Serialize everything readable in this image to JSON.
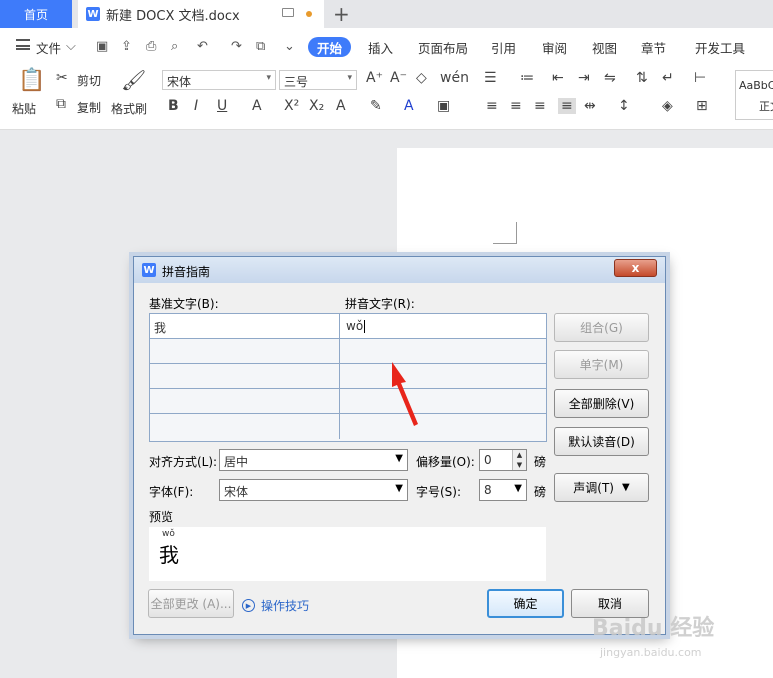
{
  "tabs": {
    "home": "首页",
    "document": "新建 DOCX 文档.docx",
    "add": "+"
  },
  "menu": {
    "file": "文件",
    "items": [
      "开始",
      "插入",
      "页面布局",
      "引用",
      "审阅",
      "视图",
      "章节",
      "开发工具"
    ]
  },
  "ribbon": {
    "paste": "粘贴",
    "cut": "剪切",
    "copy": "复制",
    "format_painter": "格式刷",
    "font_name": "宋体",
    "font_size": "三号",
    "style_preview": "AaBbC",
    "style_label": "正文"
  },
  "dialog": {
    "title": "拼音指南",
    "close": "x",
    "base_text_label": "基准文字(B):",
    "ruby_text_label": "拼音文字(R):",
    "rows": [
      {
        "base": "我",
        "ruby": "wǒ"
      },
      {
        "base": "",
        "ruby": ""
      },
      {
        "base": "",
        "ruby": ""
      },
      {
        "base": "",
        "ruby": ""
      },
      {
        "base": "",
        "ruby": ""
      }
    ],
    "buttons": {
      "group": "组合(G)",
      "mono": "单字(M)",
      "clear_all": "全部删除(V)",
      "default_reading": "默认读音(D)",
      "tone": "声调(T)",
      "change_all": "全部更改 (A)...",
      "ok": "确定",
      "cancel": "取消"
    },
    "align_label": "对齐方式(L):",
    "align_value": "居中",
    "offset_label": "偏移量(O):",
    "offset_value": "0",
    "offset_unit": "磅",
    "font_label": "字体(F):",
    "font_value": "宋体",
    "size_label": "字号(S):",
    "size_value": "8",
    "size_unit": "磅",
    "preview_label": "预览",
    "preview_pinyin": "wǒ",
    "preview_char": "我",
    "tips": "操作技巧"
  },
  "watermark": {
    "brand": "Baidu 经验",
    "url": "jingyan.baidu.com"
  },
  "colors": {
    "accent": "#3e7bfa",
    "annotation_arrow": "#e8251b"
  }
}
